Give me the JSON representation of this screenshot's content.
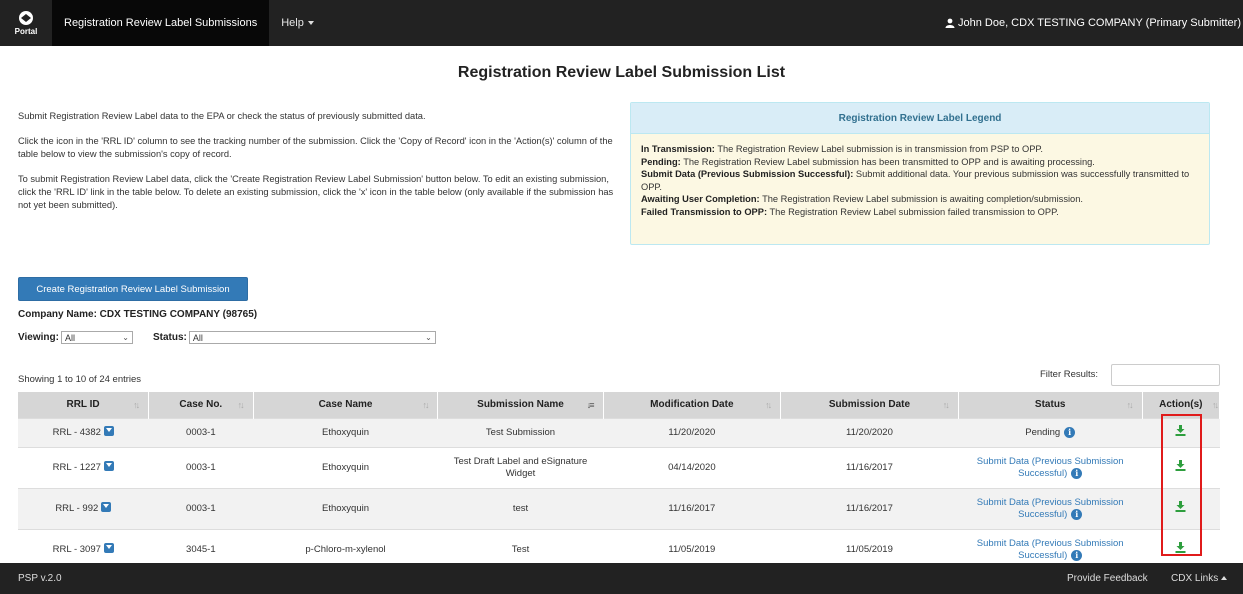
{
  "nav": {
    "logo_text": "Portal",
    "items": [
      {
        "label": "Registration Review Label Submissions"
      },
      {
        "label": "Help"
      }
    ],
    "user": "John Doe, CDX TESTING COMPANY (Primary Submitter)"
  },
  "page_title": "Registration Review Label Submission List",
  "intro": {
    "p1": "Submit Registration Review Label data to the EPA or check the status of previously submitted data.",
    "p2": "Click the icon in the 'RRL ID' column to see the tracking number of the submission. Click the 'Copy of Record' icon in the 'Action(s)' column of the table below to view the submission's copy of record.",
    "p3": "To submit Registration Review Label data, click the 'Create Registration Review Label Submission' button below. To edit an existing submission, click the 'RRL ID' link in the table below. To delete an existing submission, click the 'x' icon in the table below (only available if the submission has not yet been submitted)."
  },
  "legend": {
    "title": "Registration Review Label Legend",
    "items": [
      {
        "term": "In Transmission:",
        "desc": "The Registration Review Label submission is in transmission from PSP to OPP."
      },
      {
        "term": "Pending:",
        "desc": "The Registration Review Label submission has been transmitted to OPP and is awaiting processing."
      },
      {
        "term": "Submit Data (Previous Submission Successful):",
        "desc": "Submit additional data. Your previous submission was successfully transmitted to OPP."
      },
      {
        "term": "Awaiting User Completion:",
        "desc": "The Registration Review Label submission is awaiting completion/submission."
      },
      {
        "term": "Failed Transmission to OPP:",
        "desc": "The Registration Review Label submission failed transmission to OPP."
      }
    ]
  },
  "create_button": "Create Registration Review Label Submission",
  "company": "Company Name: CDX TESTING COMPANY (98765)",
  "filters": {
    "viewing_label": "Viewing:",
    "viewing_value": "All",
    "status_label": "Status:",
    "status_value": "All"
  },
  "showing": "Showing 1 to 10 of 24 entries",
  "filter_results_label": "Filter Results:",
  "table": {
    "headers": [
      "RRL ID",
      "Case No.",
      "Case Name",
      "Submission Name",
      "Modification Date",
      "Submission Date",
      "Status",
      "Action(s)"
    ],
    "rows": [
      {
        "rrl_id": "RRL - 4382",
        "case_no": "0003-1",
        "case_name": "Ethoxyquin",
        "submission_name": "Test Submission",
        "modified": "11/20/2020",
        "submitted": "11/20/2020",
        "status": "Pending"
      },
      {
        "rrl_id": "RRL - 1227",
        "case_no": "0003-1",
        "case_name": "Ethoxyquin",
        "submission_name": "Test Draft Label and eSignature Widget",
        "modified": "04/14/2020",
        "submitted": "11/16/2017",
        "status": "Submit Data (Previous Submission Successful)"
      },
      {
        "rrl_id": "RRL - 992",
        "case_no": "0003-1",
        "case_name": "Ethoxyquin",
        "submission_name": "test",
        "modified": "11/16/2017",
        "submitted": "11/16/2017",
        "status": "Submit Data (Previous Submission Successful)"
      },
      {
        "rrl_id": "RRL - 3097",
        "case_no": "3045-1",
        "case_name": "p-Chloro-m-xylenol",
        "submission_name": "Test",
        "modified": "11/05/2019",
        "submitted": "11/05/2019",
        "status": "Submit Data (Previous Submission Successful)"
      }
    ]
  },
  "footer": {
    "version": "PSP v.2.0",
    "feedback": "Provide Feedback",
    "links": "CDX Links"
  },
  "colors": {
    "navbar": "#222222",
    "primary": "#337ab7",
    "download": "#2e9e3e",
    "highlight_box": "#e01b1b"
  }
}
